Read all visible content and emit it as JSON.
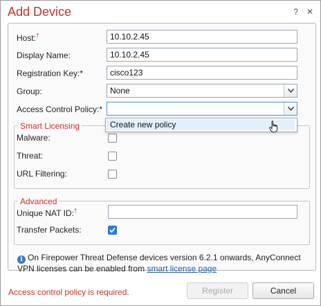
{
  "dialog": {
    "title": "Add Device",
    "help_icon": "?",
    "close_icon": "✕"
  },
  "form": {
    "host_label": "Host:",
    "host_required": "†",
    "host_value": "10.10.2.45",
    "display_name_label": "Display Name:",
    "display_name_value": "10.10.2.45",
    "registration_key_label": "Registration Key:*",
    "registration_key_value": "cisco123",
    "group_label": "Group:",
    "group_value": "None",
    "access_policy_label": "Access Control Policy:*",
    "access_policy_value": "",
    "access_policy_options": [
      "Create new policy"
    ]
  },
  "smart_licensing": {
    "legend": "Smart Licensing",
    "malware_label": "Malware:",
    "malware_checked": false,
    "threat_label": "Threat:",
    "threat_checked": false,
    "url_filtering_label": "URL Filtering:",
    "url_filtering_checked": false
  },
  "advanced": {
    "legend": "Advanced",
    "unique_nat_label": "Unique NAT ID:",
    "unique_nat_required": "†",
    "unique_nat_value": "",
    "transfer_packets_label": "Transfer Packets:",
    "transfer_packets_checked": true
  },
  "info": {
    "icon": "i",
    "text": "On Firepower Threat Defense devices version 6.2.1 onwards, AnyConnect VPN licenses can be enabled from ",
    "link_text": "smart license page"
  },
  "footer": {
    "error_text": "Access control policy is required.",
    "register_label": "Register",
    "cancel_label": "Cancel"
  },
  "colors": {
    "title_red": "#c8302a",
    "accent_blue": "#2f7fd8",
    "highlight": "#e3effb"
  }
}
